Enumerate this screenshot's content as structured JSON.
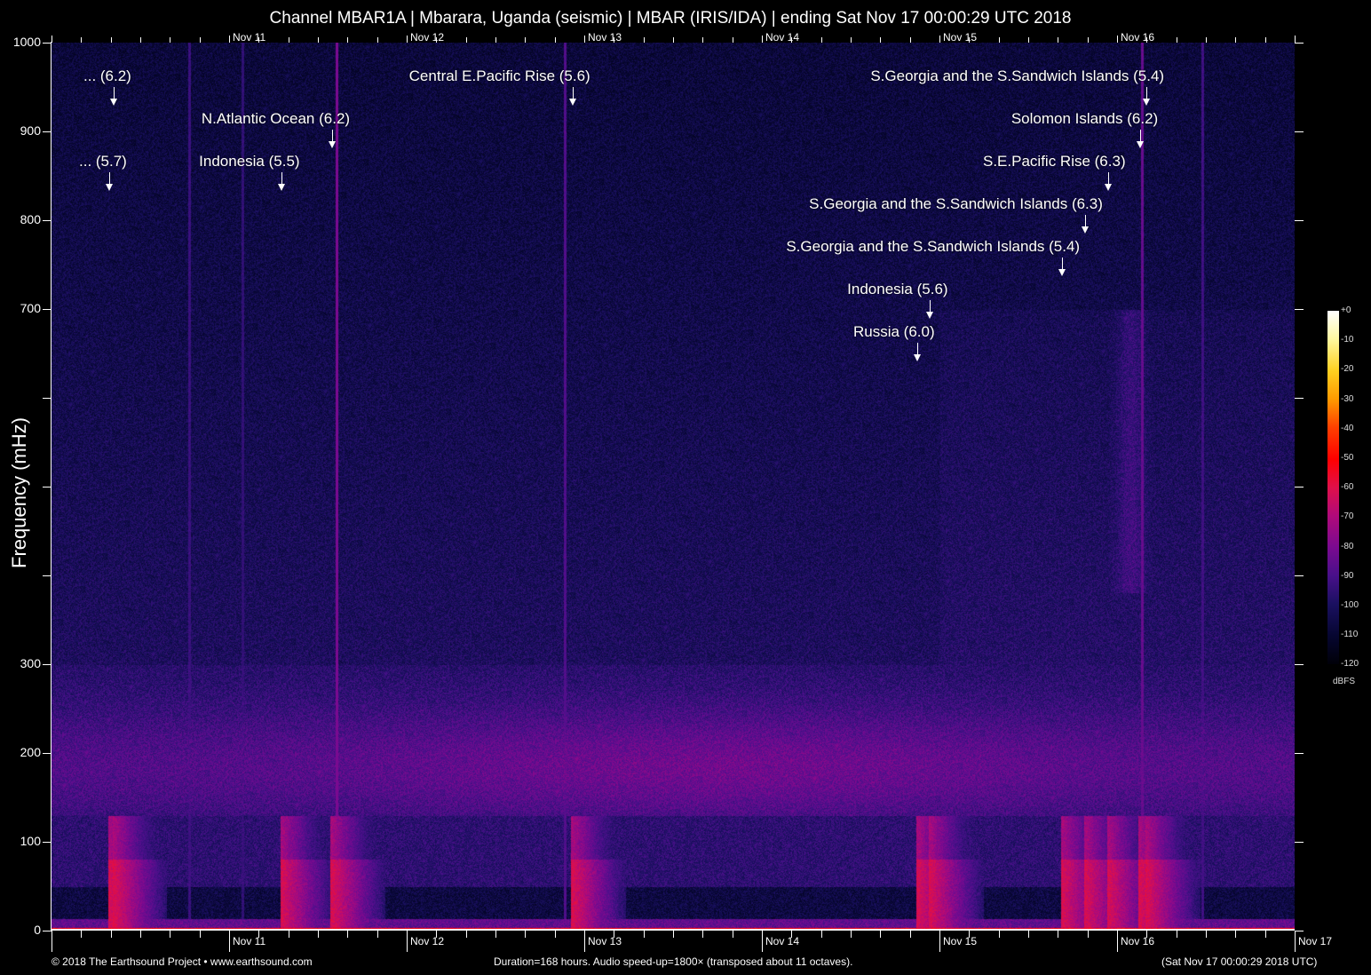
{
  "chart_data": {
    "type": "heatmap",
    "title": "Channel MBAR1A | Mbarara, Uganda (seismic) | MBAR (IRIS/IDA) | ending Sat Nov 17 00:00:29 UTC 2018",
    "xlabel": "",
    "ylabel": "Frequency (mHz)",
    "xrange_hours": [
      0,
      168
    ],
    "ylim": [
      0,
      1000
    ],
    "x_ticks_top": [
      {
        "hour": 24,
        "label": "Nov 11"
      },
      {
        "hour": 48,
        "label": "Nov 12"
      },
      {
        "hour": 72,
        "label": "Nov 13"
      },
      {
        "hour": 96,
        "label": "Nov 14"
      },
      {
        "hour": 120,
        "label": "Nov 15"
      },
      {
        "hour": 144,
        "label": "Nov 16"
      }
    ],
    "x_ticks_bottom": [
      {
        "hour": 24,
        "label": "Nov 11"
      },
      {
        "hour": 48,
        "label": "Nov 12"
      },
      {
        "hour": 72,
        "label": "Nov 13"
      },
      {
        "hour": 96,
        "label": "Nov 14"
      },
      {
        "hour": 120,
        "label": "Nov 15"
      },
      {
        "hour": 144,
        "label": "Nov 16"
      },
      {
        "hour": 168,
        "label": "Nov 17"
      }
    ],
    "y_ticks": [
      {
        "value": 0,
        "label": "0"
      },
      {
        "value": 100,
        "label": "100"
      },
      {
        "value": 200,
        "label": "200"
      },
      {
        "value": 300,
        "label": "300"
      },
      {
        "value": 400,
        "label": ""
      },
      {
        "value": 500,
        "label": ""
      },
      {
        "value": 600,
        "label": ""
      },
      {
        "value": 700,
        "label": "700"
      },
      {
        "value": 800,
        "label": "800"
      },
      {
        "value": 900,
        "label": "900"
      },
      {
        "value": 1000,
        "label": "1000"
      }
    ],
    "colorbar": {
      "unit": "dBFS",
      "range": [
        -120,
        0
      ],
      "labels": [
        "+0",
        "-10",
        "-20",
        "-30",
        "-40",
        "-50",
        "-60",
        "-70",
        "-80",
        "-90",
        "-100",
        "-110",
        "-120"
      ]
    },
    "annotations": [
      {
        "label": "... (6.2)",
        "hour": 8.4
      },
      {
        "label": "N.Atlantic Ocean (6.2)",
        "hour": 37.9
      },
      {
        "label": "... (5.7)",
        "hour": 7.8
      },
      {
        "label": "Indonesia (5.5)",
        "hour": 31.1
      },
      {
        "label": "Central E.Pacific Rise (5.6)",
        "hour": 70.4
      },
      {
        "label": "S.Georgia and the S.Sandwich Islands (5.4)",
        "hour": 148.0
      },
      {
        "label": "Solomon Islands (6.2)",
        "hour": 147.1
      },
      {
        "label": "S.E.Pacific Rise (6.3)",
        "hour": 142.8
      },
      {
        "label": "S.Georgia and the S.Sandwich Islands (6.3)",
        "hour": 139.7
      },
      {
        "label": "S.Georgia and the S.Sandwich Islands (5.4)",
        "hour": 136.6
      },
      {
        "label": "Indonesia (5.6)",
        "hour": 118.7
      },
      {
        "label": "Russia (6.0)",
        "hour": 117.0
      }
    ]
  },
  "footer": {
    "copyright": "© 2018 The Earthsound Project • www.earthsound.com",
    "info": "Duration=168 hours. Audio speed-up=1800× (transposed about 11 octaves).",
    "end_time": "(Sat Nov 17 00:00:29 2018 UTC)"
  }
}
